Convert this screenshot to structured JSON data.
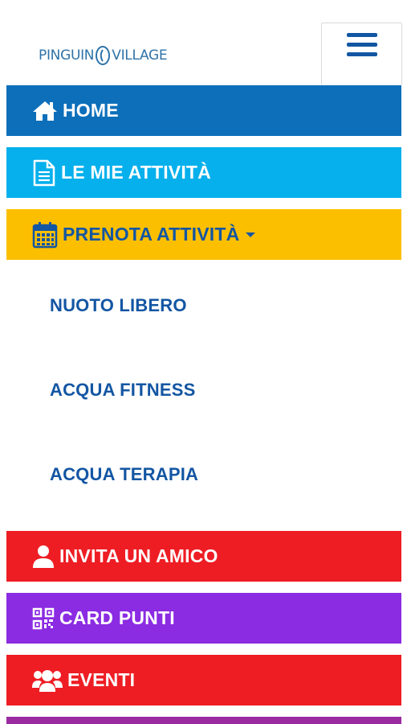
{
  "brand": {
    "logo_left": "PINGUIN",
    "logo_right": "VILLAGE",
    "color": "#2f73a8"
  },
  "header": {
    "menu_toggle_icon": "hamburger-icon"
  },
  "menu": {
    "home": {
      "label": "HOME",
      "icon": "house-icon",
      "color": "#0d6fba"
    },
    "attivita": {
      "label": "LE MIE ATTIVITÀ",
      "icon": "document-icon",
      "color": "#06b0ec"
    },
    "prenota": {
      "label": "PRENOTA ATTIVITÀ",
      "icon": "calendar-icon",
      "color": "#fcbf00",
      "expanded": true,
      "submenu": [
        {
          "label": "NUOTO LIBERO"
        },
        {
          "label": "ACQUA FITNESS"
        },
        {
          "label": "ACQUA TERAPIA"
        }
      ]
    },
    "invita": {
      "label": "INVITA UN AMICO",
      "icon": "user-icon",
      "color": "#ee1d24"
    },
    "card": {
      "label": "CARD PUNTI",
      "icon": "qrcode-icon",
      "color": "#8b2be2"
    },
    "eventi": {
      "label": "EVENTI",
      "icon": "users-icon",
      "color": "#ee1d24"
    }
  },
  "colors": {
    "text_accent": "#1356a3"
  }
}
